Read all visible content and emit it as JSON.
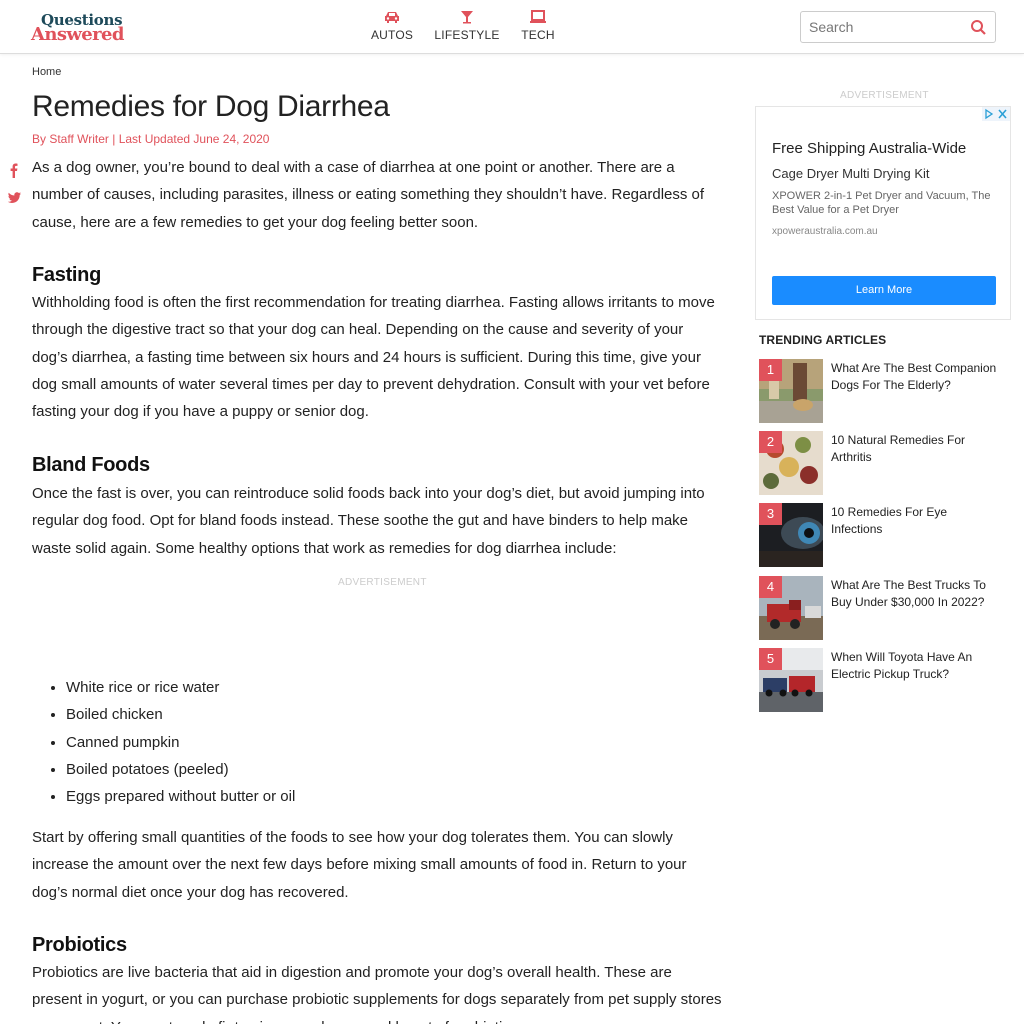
{
  "header": {
    "logo_line1": "Questions",
    "logo_line2": "Answered",
    "nav": [
      {
        "label": "AUTOS",
        "icon": "car-icon"
      },
      {
        "label": "LIFESTYLE",
        "icon": "cocktail-icon"
      },
      {
        "label": "TECH",
        "icon": "laptop-icon"
      }
    ],
    "search_placeholder": "Search"
  },
  "article": {
    "breadcrumb": "Home",
    "title": "Remedies for Dog Diarrhea",
    "byline": "By Staff Writer | Last Updated June 24, 2020",
    "intro": "As a dog owner, you’re bound to deal with a case of diarrhea at one point or another. There are a number of causes, including parasites, illness or eating something they shouldn’t have. Regardless of cause, here are a few remedies to get your dog feeling better soon.",
    "sections": [
      {
        "heading": "Fasting",
        "body": "Withholding food is often the first recommendation for treating diarrhea. Fasting allows irritants to move through the digestive tract so that your dog can heal. Depending on the cause and severity of your dog’s diarrhea, a fasting time between six hours and 24 hours is sufficient. During this time, give your dog small amounts of water several times per day to prevent dehydration. Consult with your vet before fasting your dog if you have a puppy or senior dog."
      },
      {
        "heading": "Bland Foods",
        "body": "Once the fast is over, you can reintroduce solid foods back into your dog’s diet, but avoid jumping into regular dog food. Opt for bland foods instead. These soothe the gut and have binders to help make waste solid again. Some healthy options that work as remedies for dog diarrhea include:",
        "list": [
          "White rice or rice water",
          "Boiled chicken",
          "Canned pumpkin",
          "Boiled potatoes (peeled)",
          "Eggs prepared without butter or oil"
        ],
        "after": "Start by offering small quantities of the foods to see how your dog tolerates them. You can slowly increase the amount over the next few days before mixing small amounts of food in. Return to your dog’s normal diet once your dog has recovered."
      },
      {
        "heading": "Probiotics",
        "body": "Probiotics are live bacteria that aid in digestion and promote your dog’s overall health. These are present in yogurt, or you can purchase probiotic supplements for dogs separately from pet supply stores or your vet. You can try a kefir to give your dog a good boost of probiotics."
      }
    ],
    "ad_label": "ADVERTISEMENT"
  },
  "sidebar": {
    "ad_label": "ADVERTISEMENT",
    "ad": {
      "headline": "Free Shipping Australia-Wide",
      "subhead": "Cage Dryer Multi Drying Kit",
      "description": "XPOWER 2-in-1 Pet Dryer and Vacuum, The Best Value for a Pet Dryer",
      "url": "xpoweraustralia.com.au",
      "button": "Learn More"
    },
    "trending_heading": "TRENDING ARTICLES",
    "trending": [
      {
        "num": "1",
        "title": "What Are The Best Companion Dogs For The Elderly?"
      },
      {
        "num": "2",
        "title": "10 Natural Remedies For Arthritis"
      },
      {
        "num": "3",
        "title": "10 Remedies For Eye Infections"
      },
      {
        "num": "4",
        "title": "What Are The Best Trucks To Buy Under $30,000 In 2022?"
      },
      {
        "num": "5",
        "title": "When Will Toyota Have An Electric Pickup Truck?"
      }
    ]
  },
  "colors": {
    "accent": "#e0525b",
    "logo_dark": "#1e4a5a",
    "ad_button": "#1a8cff"
  }
}
